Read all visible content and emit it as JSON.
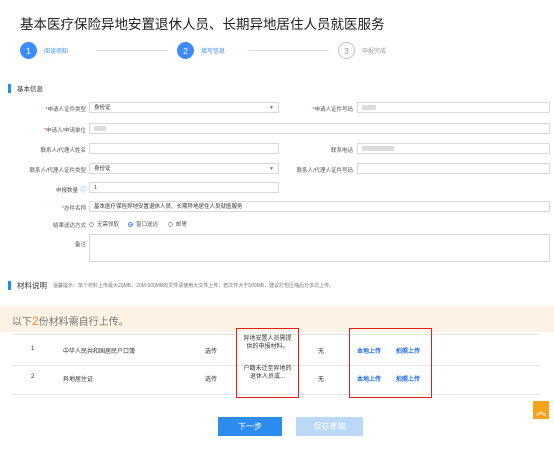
{
  "page_title": "基本医疗保险异地安置退休人员、长期异地居住人员就医服务",
  "steps": [
    {
      "number": "1",
      "label": "阅读须知",
      "state": "done"
    },
    {
      "number": "2",
      "label": "填写信息",
      "state": "active"
    },
    {
      "number": "3",
      "label": "申报完成",
      "state": "todo"
    }
  ],
  "basic_info": {
    "title": "基本信息",
    "required_mark": "*",
    "applicant_id_type_label": "申请人证件类型",
    "applicant_id_type_value": "身份证",
    "applicant_id_number_label": "申请人证件号码",
    "applicant_name_label": "申请人/申请单位",
    "contact_name_label": "联系人/代理人姓名",
    "contact_phone_label": "联系电话",
    "contact_id_type_label": "联系人/代理人证件类型",
    "contact_id_type_value": "身份证",
    "contact_id_number_label": "联系人/代理人证件号码",
    "quantity_label": "申报数量",
    "quantity_value": "1",
    "item_name_label": "办件名称",
    "item_name_value": "基本医疗保险异地安置退休人员、长期异地居住人员就医服务",
    "delivery_label": "结果送达方式",
    "delivery_options": [
      "无需领取",
      "窗口送达",
      "邮寄"
    ],
    "delivery_selected": "窗口送达",
    "remark_label": "备注"
  },
  "materials": {
    "title": "材料说明",
    "tip": "温馨提示：单个材料上传最大20MB，20M-500MB的文件请使用大文件上传，若文件大于500MB，建议打包压缩后分多次上传。",
    "banner_prefix": "以下",
    "banner_count": "2",
    "banner_suffix": "份材料需自行上传。",
    "rows": [
      {
        "index": "1",
        "name": "中华人民共和国居民户口簿",
        "status": "选传",
        "note": "异地安置人员需提供的申报材料。",
        "sample": "无",
        "upload_label": "本地上传",
        "photo_label": "拍照上传"
      },
      {
        "index": "2",
        "name": "异地居住证",
        "status": "选传",
        "note": "户籍未迁至异地的退休人员或...",
        "sample": "无",
        "upload_label": "本地上传",
        "photo_label": "拍照上传"
      }
    ]
  },
  "buttons": {
    "next": "下一步",
    "save_draft": "保存草稿"
  },
  "back_to_top": "︽",
  "colors": {
    "accent": "#2d8cf0",
    "highlight_box": "#e02020",
    "banner_bg": "#fdf3e4",
    "banner_number": "#ff8f1f"
  }
}
